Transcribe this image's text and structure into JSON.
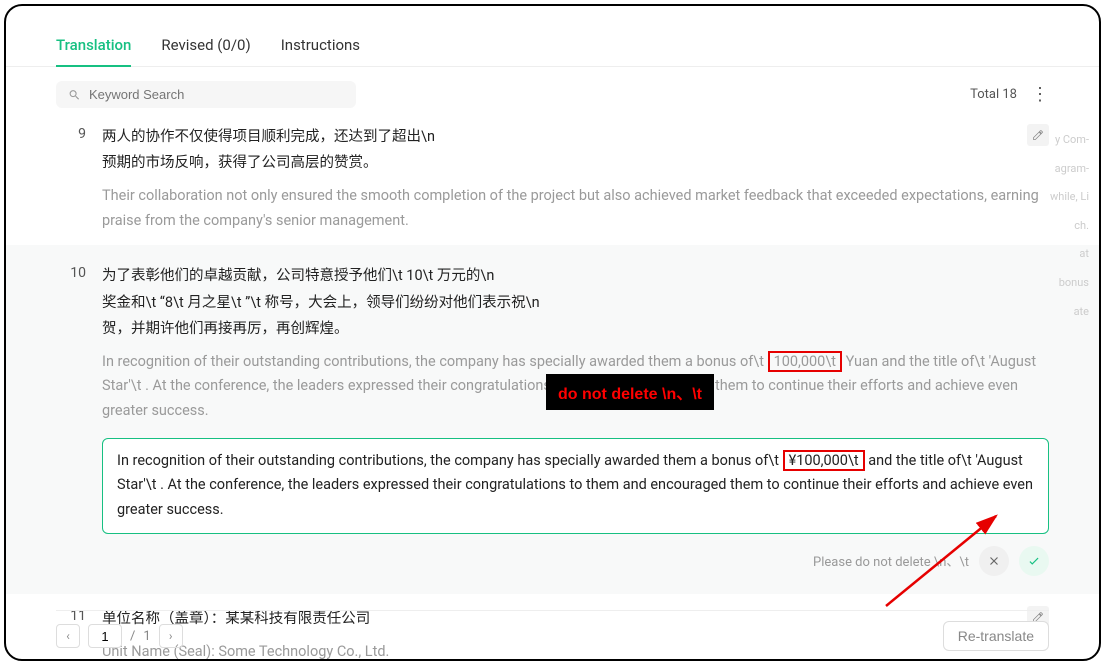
{
  "tabs": {
    "translation": "Translation",
    "revised": "Revised (0/0)",
    "instructions": "Instructions"
  },
  "search": {
    "placeholder": "Keyword Search"
  },
  "total_label": "Total 18",
  "rows": {
    "r9": {
      "num": "9",
      "src_l1": "两人的协作不仅使得项目顺利完成，还达到了超出\\n",
      "src_l2": "预期的市场反响，获得了公司高层的赞赏。",
      "tgt": "Their collaboration not only ensured the smooth completion of the project but also achieved market feedback that exceeded expectations, earning praise from the company's senior management."
    },
    "r10": {
      "num": "10",
      "src_l1": "为了表彰他们的卓越贡献，公司特意授予他们\\t   10\\t 万元的\\n",
      "src_l2": "奖金和\\t “8\\t 月之星\\t ”\\t   称号，大会上，领导们纷纷对他们表示祝\\n",
      "src_l3": "贺，并期许他们再接再厉，再创辉煌。",
      "tgt_pre": "In recognition of their outstanding contributions, the company has specially awarded them a bonus of\\t   ",
      "tgt_box": "100,000\\t",
      "tgt_post": "  Yuan and the title of\\t   'August Star'\\t . At the conference, the leaders expressed their congratulations to them and encouraged them to continue their efforts and achieve even greater success.",
      "edit_pre": "In recognition of their outstanding contributions, the company has specially awarded them a bonus of\\t   ",
      "edit_box": "¥100,000\\t",
      "edit_post": " and the title of\\t   'August Star'\\t . At the conference, the leaders expressed their congratulations to them and encouraged them to continue their efforts and achieve even greater success.",
      "hint": "Please do not delete \\n、\\t"
    },
    "r11": {
      "num": "11",
      "src": "单位名称（盖章）：某某科技有限责任公司",
      "tgt": "Unit Name (Seal): Some Technology Co., Ltd."
    }
  },
  "callout": "do not delete \\n、\\t",
  "pager": {
    "page": "1",
    "total": "1",
    "retranslate": "Re-translate"
  },
  "side_ghost": [
    "y Com-",
    "",
    "agram-",
    "while, Li",
    "ch.",
    "at",
    "bonus",
    "ate"
  ],
  "colors": {
    "accent": "#17c082",
    "danger": "#e60000"
  }
}
